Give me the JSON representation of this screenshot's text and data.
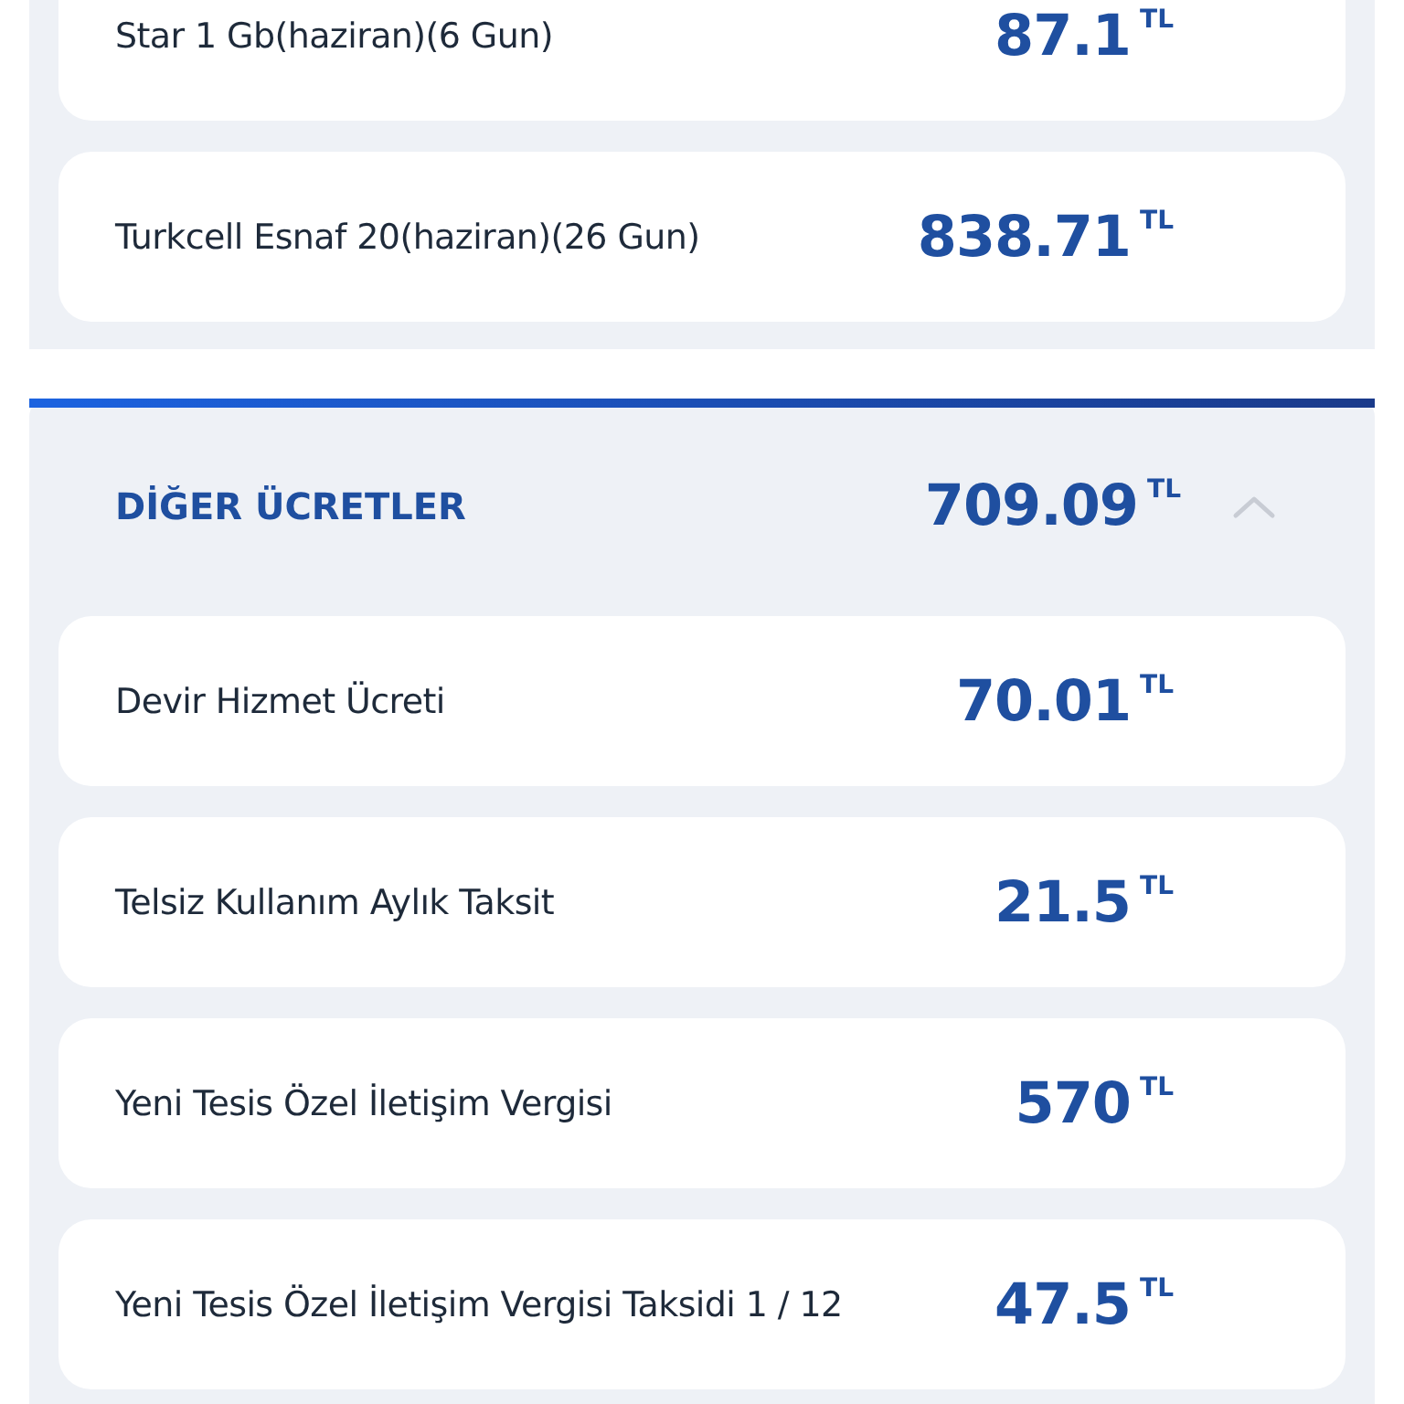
{
  "sections": [
    {
      "items": [
        {
          "label": "Star 1 Gb(haziran)(6 Gun)",
          "amount": "87.1",
          "currency": "TL"
        },
        {
          "label": "Turkcell Esnaf 20(haziran)(26 Gun)",
          "amount": "838.71",
          "currency": "TL"
        }
      ]
    },
    {
      "title": "DİĞER ÜCRETLER",
      "total": "709.09",
      "currency": "TL",
      "expanded": true,
      "items": [
        {
          "label": "Devir Hizmet Ücreti",
          "amount": "70.01",
          "currency": "TL"
        },
        {
          "label": "Telsiz Kullanım Aylık Taksit",
          "amount": "21.5",
          "currency": "TL"
        },
        {
          "label": "Yeni Tesis Özel İletişim Vergisi",
          "amount": "570",
          "currency": "TL"
        },
        {
          "label": "Yeni Tesis Özel İletişim Vergisi Taksidi 1 / 12",
          "amount": "47.5",
          "currency": "TL"
        }
      ]
    }
  ]
}
